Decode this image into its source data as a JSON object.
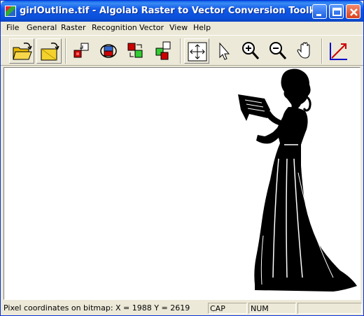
{
  "window": {
    "title": "girlOutline.tif - Algolab Raster to Vector Conversion Toolkit"
  },
  "titlebar_buttons": {
    "minimize": "minimize-icon",
    "maximize": "maximize-icon",
    "close": "close-icon"
  },
  "menu": [
    "File",
    "General",
    "Raster",
    "Recognition",
    "Vector",
    "View",
    "Help"
  ],
  "toolbar": {
    "buttons": [
      {
        "name": "open-file",
        "icon": "folder-open-icon"
      },
      {
        "name": "save-file",
        "icon": "save-icon"
      },
      {
        "name": "raster-op-1",
        "icon": "raster-transfer-icon"
      },
      {
        "name": "raster-op-2",
        "icon": "raster-convert-icon"
      },
      {
        "name": "raster-op-3",
        "icon": "raster-swap-icon"
      },
      {
        "name": "raster-op-4",
        "icon": "raster-merge-icon"
      },
      {
        "name": "fit-window",
        "icon": "fit-window-icon"
      },
      {
        "name": "select-pointer",
        "icon": "pointer-icon"
      },
      {
        "name": "zoom-in",
        "icon": "zoom-in-icon"
      },
      {
        "name": "zoom-out",
        "icon": "zoom-out-icon"
      },
      {
        "name": "pan-hand",
        "icon": "hand-icon"
      },
      {
        "name": "vectorize",
        "icon": "vectorize-icon"
      }
    ]
  },
  "status": {
    "coords": "Pixel coordinates on bitmap:   X  =  1988   Y  =  2619",
    "cap": "CAP",
    "num": "NUM"
  },
  "colors": {
    "titlebar": "#0a4fd8",
    "face": "#ece9d8",
    "canvas": "#ffffff"
  }
}
